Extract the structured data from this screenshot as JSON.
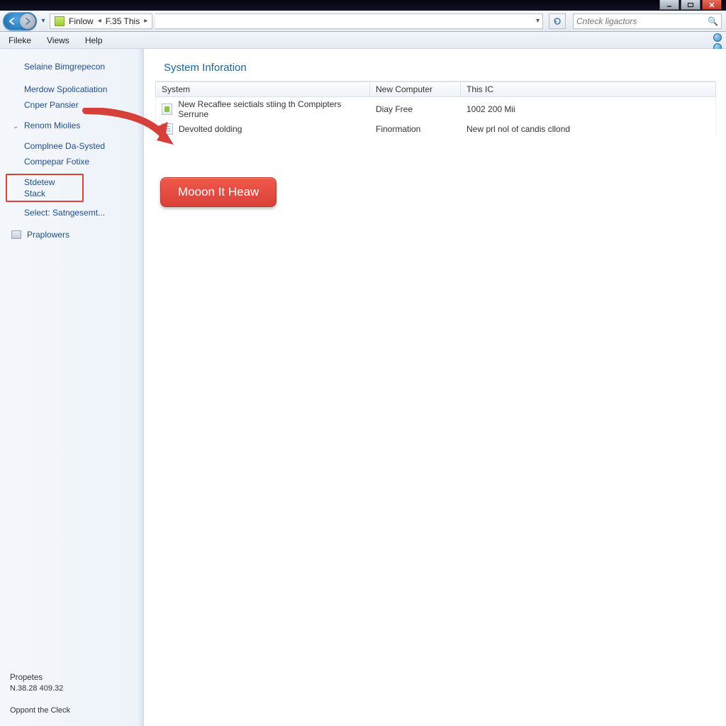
{
  "titlebar": {},
  "toolbar": {
    "crumb_root": "Finlow",
    "crumb_leaf": "F.35 This",
    "search_placeholder": "Cnteck ligactors"
  },
  "menu": {
    "file": "Fileke",
    "views": "Views",
    "help": "Help"
  },
  "sidebar": {
    "links": [
      "Selaine Bimgrepecon",
      "Merdow Spolicatiation",
      "Cnper Pansier"
    ],
    "group_label": "Renom Miolies",
    "group_items": [
      "Complnee Da-Systed",
      "Compepar Fotixe"
    ],
    "highlight": "Stdetew Stack",
    "after_highlight": "Select: Satngesemt...",
    "icon_link": "Praplowers",
    "footer_title": "Propetes",
    "footer_value": "N.38.28 409.32",
    "footer_action": "Oppont the Cleck"
  },
  "main": {
    "section_title": "System Inforation",
    "columns": [
      "System",
      "New Computer",
      "This IC"
    ],
    "rows": [
      {
        "name": "New Recaflee seictials stiing th Compipters Serrune",
        "c2": "Diay Free",
        "c3": "1002 200 Mii"
      },
      {
        "name": "Devolted dolding",
        "c2": "Finormation",
        "c3": "New prl nol of candis cllond"
      }
    ]
  },
  "callout": {
    "text": "Mooon It Heaw"
  }
}
